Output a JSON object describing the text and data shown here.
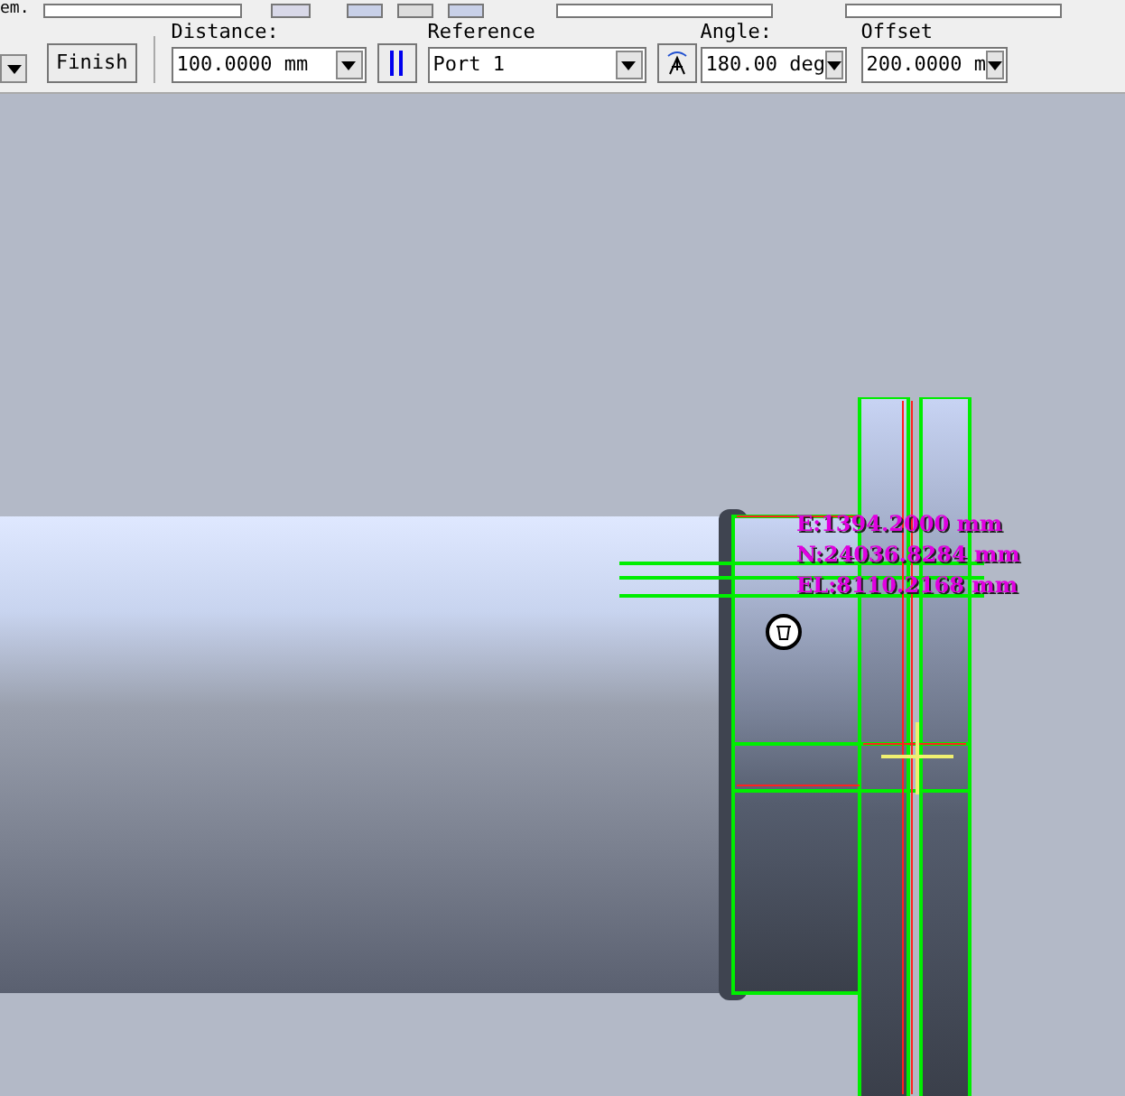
{
  "toolbar": {
    "top_label": "em.",
    "finish_button": "Finish",
    "fields": [
      {
        "kind": "combo",
        "label": "Distance:",
        "value": "100.0000 mm"
      },
      {
        "kind": "combo",
        "label": "Reference",
        "value": "Port 1"
      },
      {
        "kind": "combo",
        "label": "Angle:",
        "value": "180.00 deg"
      },
      {
        "kind": "combo",
        "label": "Offset",
        "value": "200.0000 m"
      }
    ]
  },
  "viewport": {
    "coordinates": [
      "E:1394.2000 mm",
      "N:24036.8284 mm",
      "EL:8110.2168 mm"
    ]
  }
}
